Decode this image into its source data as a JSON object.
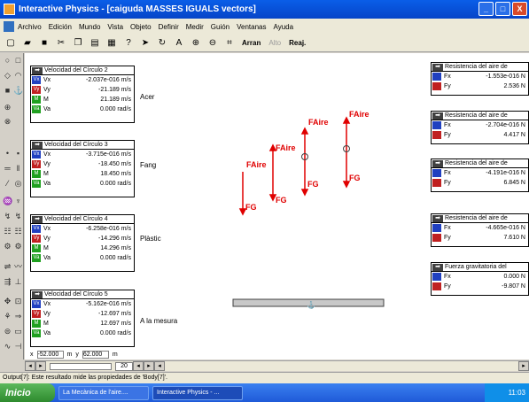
{
  "window": {
    "title": "Interactive Physics - [caiguda MASSES IGUALS vectors]",
    "btn_min": "_",
    "btn_max": "□",
    "btn_close": "X"
  },
  "menu": [
    "Archivo",
    "Edición",
    "Mundo",
    "Vista",
    "Objeto",
    "Definir",
    "Medir",
    "Guión",
    "Ventanas",
    "Ayuda"
  ],
  "toolbar": {
    "run": "Arran",
    "stop": "Alto",
    "reset": "Reaj."
  },
  "meters": [
    {
      "title": "Velocidad del Círculo 2",
      "material": "Acer",
      "rows": [
        {
          "badge": "Vx",
          "label": "Vx",
          "value": "-2.037e-016 m/s"
        },
        {
          "badge": "Vy",
          "label": "Vy",
          "value": "-21.189 m/s"
        },
        {
          "badge": "M",
          "label": "M",
          "value": "21.189 m/s"
        },
        {
          "badge": "Va",
          "label": "Va",
          "value": "0.000 rad/s"
        }
      ]
    },
    {
      "title": "Velocidad del Círculo 3",
      "material": "Fang",
      "rows": [
        {
          "badge": "Vx",
          "label": "Vx",
          "value": "-3.715e-016 m/s"
        },
        {
          "badge": "Vy",
          "label": "Vy",
          "value": "-18.450 m/s"
        },
        {
          "badge": "M",
          "label": "M",
          "value": "18.450 m/s"
        },
        {
          "badge": "Va",
          "label": "Va",
          "value": "0.000 rad/s"
        }
      ]
    },
    {
      "title": "Velocidad del Círculo 4",
      "material": "Plàstic",
      "rows": [
        {
          "badge": "Vx",
          "label": "Vx",
          "value": "-6.258e-016 m/s"
        },
        {
          "badge": "Vy",
          "label": "Vy",
          "value": "-14.296 m/s"
        },
        {
          "badge": "M",
          "label": "M",
          "value": "14.296 m/s"
        },
        {
          "badge": "Va",
          "label": "Va",
          "value": "0.000 rad/s"
        }
      ]
    },
    {
      "title": "Velocidad del Círculo 5",
      "material": "A la mesura",
      "rows": [
        {
          "badge": "Vx",
          "label": "Vx",
          "value": "-5.162e-016 m/s"
        },
        {
          "badge": "Vy",
          "label": "Vy",
          "value": "-12.697 m/s"
        },
        {
          "badge": "M",
          "label": "M",
          "value": "12.697 m/s"
        },
        {
          "badge": "Va",
          "label": "Va",
          "value": "0.000 rad/s"
        }
      ]
    }
  ],
  "right_meters": [
    {
      "title": "Resistencia del aire de",
      "rows": [
        {
          "label": "Fx",
          "value": "-1.553e-016 N"
        },
        {
          "label": "Fy",
          "value": "2.536 N"
        }
      ]
    },
    {
      "title": "Resistencia del aire de",
      "rows": [
        {
          "label": "Fx",
          "value": "-2.704e-016 N"
        },
        {
          "label": "Fy",
          "value": "4.417 N"
        }
      ]
    },
    {
      "title": "Resistencia del aire de",
      "rows": [
        {
          "label": "Fx",
          "value": "-4.191e-016 N"
        },
        {
          "label": "Fy",
          "value": "6.845 N"
        }
      ]
    },
    {
      "title": "Resistencia del aire de",
      "rows": [
        {
          "label": "Fx",
          "value": "-4.665e-016 N"
        },
        {
          "label": "Fy",
          "value": "7.610 N"
        }
      ]
    },
    {
      "title": "Fuerza gravitatoria del",
      "rows": [
        {
          "label": "Fx",
          "value": "0.000 N"
        },
        {
          "label": "Fy",
          "value": "-9.807 N"
        }
      ]
    }
  ],
  "vectors": {
    "air_label": "FAire",
    "gravity_label": "FG"
  },
  "coords": {
    "x_label": "x",
    "x_value": "-52.000",
    "x_unit": "m",
    "y_label": "y",
    "y_value": "62.000",
    "y_unit": "m"
  },
  "scroll": {
    "zoom": "20"
  },
  "status": "Output[7]: Este resultado mide las propiedades de 'Body[7]'.",
  "taskbar": {
    "start": "Inicio",
    "task1": "La Mecànica de l'aire....",
    "task2": "Interactive Physics - ...",
    "clock": "11:03"
  }
}
